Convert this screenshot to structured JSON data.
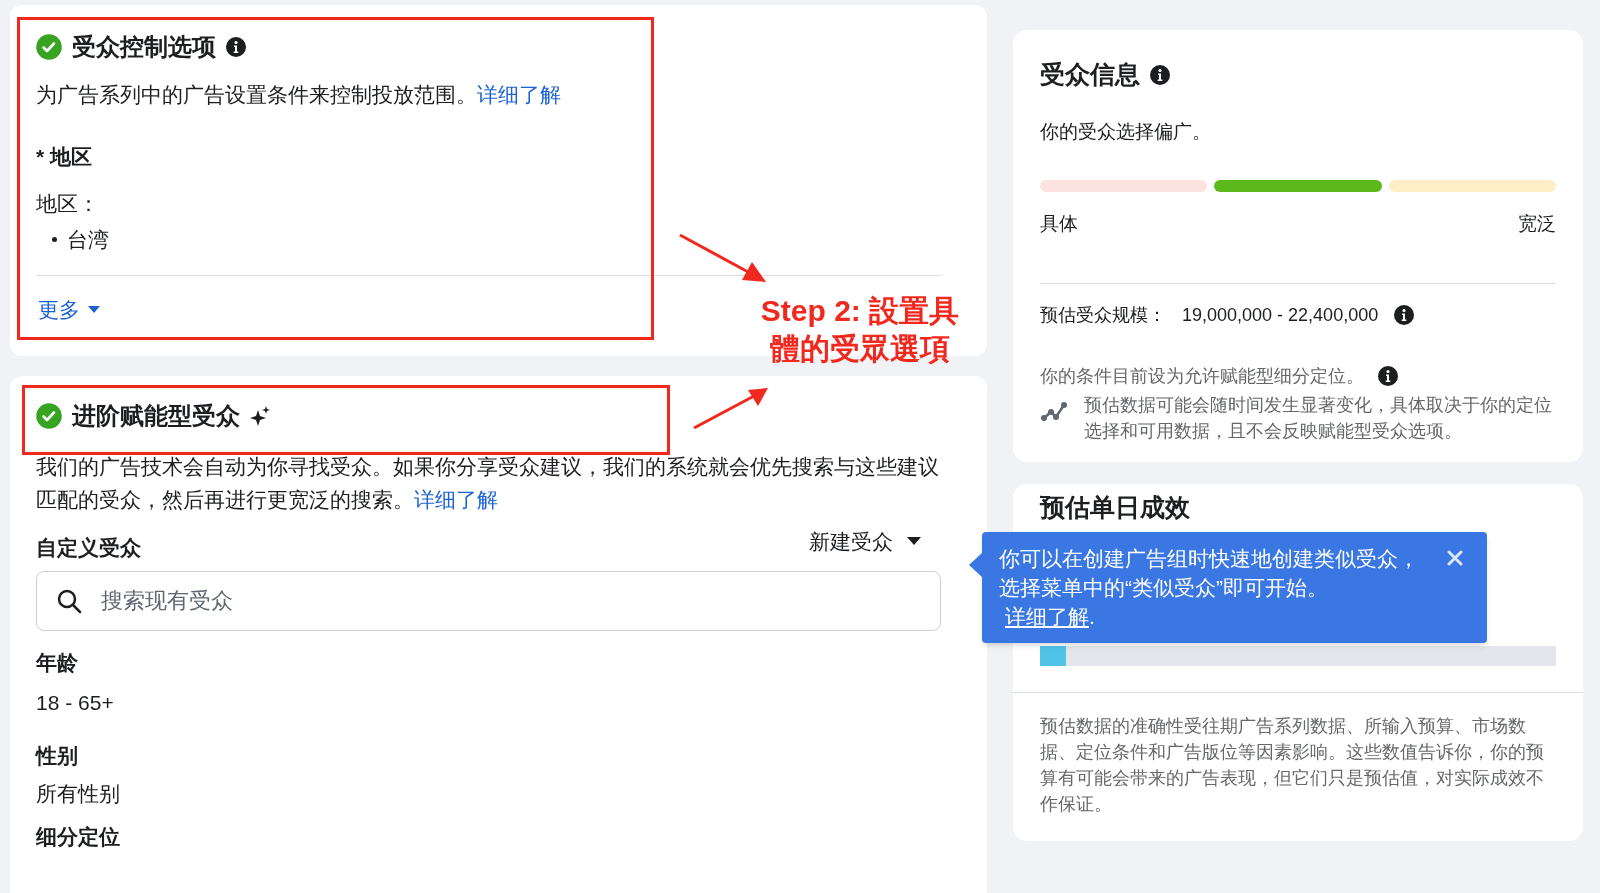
{
  "audience_controls": {
    "title": "受众控制选项",
    "checked": true,
    "description": "为广告系列中的广告设置条件来控制投放范围。",
    "learn_more": "详细了解",
    "location_heading": "* 地区",
    "location_label": "地区：",
    "locations": [
      "台湾"
    ],
    "more": "更多"
  },
  "advantage_audience": {
    "title": "进阶赋能型受众",
    "checked": true,
    "description": "我们的广告技术会自动为你寻找受众。如果你分享受众建议，我们的系统就会优先搜索与这些建议匹配的受众，然后再进行更宽泛的搜索。",
    "learn_more": "详细了解",
    "custom_audience_label": "自定义受众",
    "new_audience": "新建受众",
    "search": {
      "placeholder": "搜索现有受众"
    },
    "age_label": "年龄",
    "age": "18 - 65+",
    "gender_label": "性别",
    "gender": "所有性别",
    "detailed_targeting_label": "细分定位"
  },
  "audience_info": {
    "title": "受众信息",
    "description": "你的受众选择偏广。",
    "meter": [
      {
        "color": "#fde3e0"
      },
      {
        "color": "#5cb91b"
      },
      {
        "color": "#fdeec7"
      }
    ],
    "specific": "具体",
    "broad": "宽泛",
    "size_label": "预估受众规模：",
    "size": "19,000,000 - 22,400,000",
    "note": "你的条件目前设为允许赋能型细分定位。",
    "disclaimer": "预估数据可能会随时间发生显著变化，具体取决于你的定位选择和可用数据，且不会反映赋能型受众选项。"
  },
  "daily_results": {
    "title": "预估单日成效",
    "level": 0.05,
    "disclaimer": "预估数据的准确性受往期广告系列数据、所输入预算、市场数据、定位条件和广告版位等因素影响。这些数值告诉你，你的预算有可能会带来的广告表现，但它们只是预估值，对实际成效不作保证。"
  },
  "tooltip": {
    "text": "你可以在创建广告组时快速地创建类似受众，选择菜单中的“类似受众”即可开始。",
    "link": "详细了解",
    "after": "."
  },
  "annotation": {
    "text": "Step 2: 設置具體的受眾選項"
  }
}
